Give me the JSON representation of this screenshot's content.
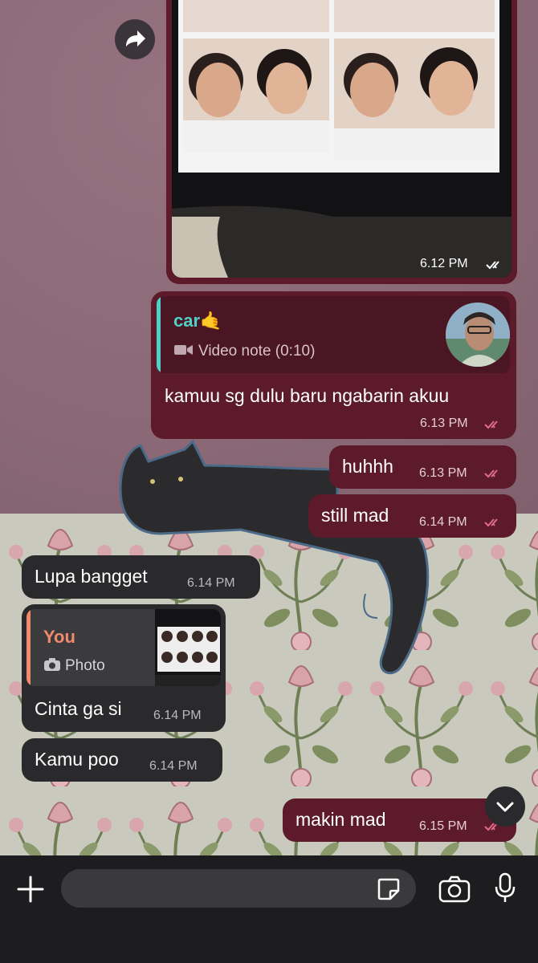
{
  "colors": {
    "outgoing_bubble": "#5c1a2b",
    "incoming_bubble": "#2a2a2c",
    "reply_name_outgoing": "#4fd1c5",
    "reply_name_incoming": "#f08a6a",
    "read_ticks": "#e06a8c"
  },
  "messages": {
    "photo_bubble": {
      "time": "6.12 PM"
    },
    "reply_bubble": {
      "quoted_name": "car🤙",
      "quoted_type": "Video note (0:10)",
      "text": "kamuu sg dulu baru ngabarin akuu",
      "time": "6.13 PM"
    },
    "huhhh": {
      "text": "huhhh",
      "time": "6.13 PM"
    },
    "still_mad": {
      "text": "still mad",
      "time": "6.14 PM"
    },
    "lupa": {
      "text": "Lupa bangget",
      "time": "6.14 PM"
    },
    "cinta": {
      "quoted_name": "You",
      "quoted_type": "Photo",
      "text": "Cinta ga si",
      "time": "6.14 PM"
    },
    "kamu_poo": {
      "text": "Kamu poo",
      "time": "6.14 PM"
    },
    "makin_mad": {
      "text": "makin mad",
      "time": "6.15 PM"
    }
  },
  "icons": {
    "forward": "forward-arrow-icon",
    "scroll_down": "chevron-down-icon",
    "attach": "plus-icon",
    "sticker": "sticker-icon",
    "camera": "camera-icon",
    "mic": "microphone-icon"
  },
  "composer": {
    "placeholder": ""
  }
}
